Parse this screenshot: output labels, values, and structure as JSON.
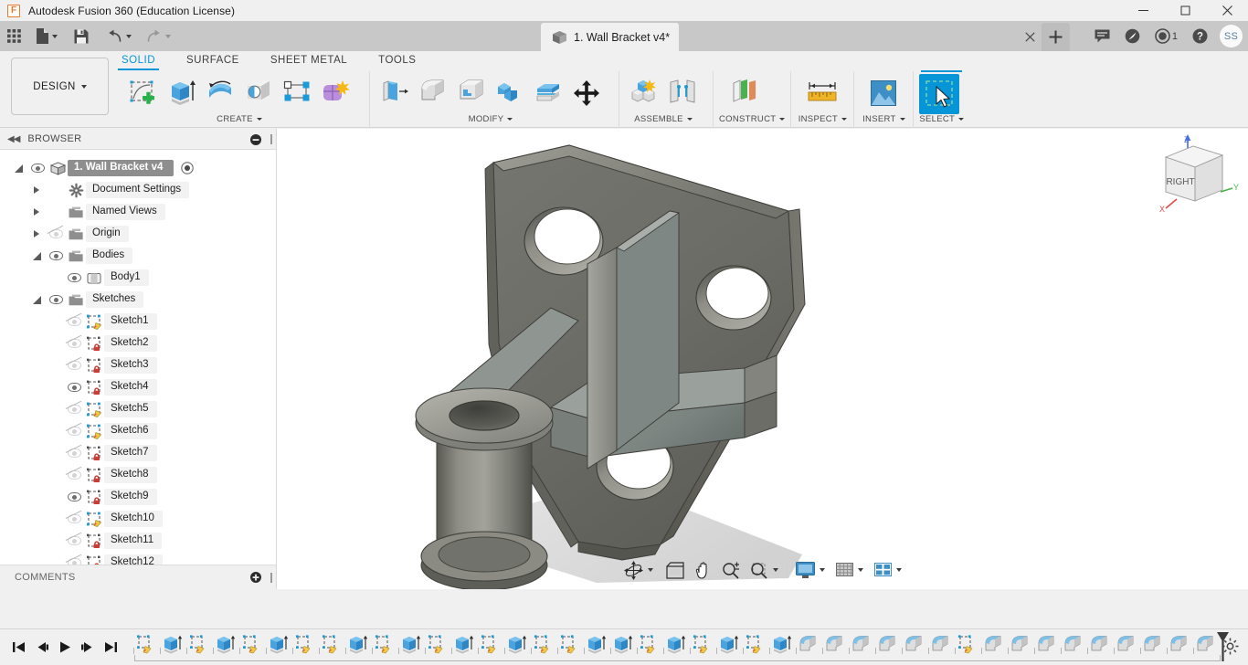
{
  "titlebar": {
    "app_title": "Autodesk Fusion 360 (Education License)",
    "app_icon": "fusion-logo-icon",
    "letter": "F",
    "minimize": "minimize-button",
    "maximize": "maximize-button",
    "close": "close-button"
  },
  "quick_access": {
    "items": [
      {
        "name": "app-grid-icon",
        "label": "",
        "dropdown": false,
        "disabled": false
      },
      {
        "name": "file-icon",
        "label": "",
        "dropdown": true,
        "disabled": false
      },
      {
        "name": "save-icon",
        "label": "",
        "dropdown": false,
        "disabled": false
      },
      {
        "name": "undo-icon",
        "label": "",
        "dropdown": true,
        "disabled": false
      },
      {
        "name": "redo-icon",
        "label": "",
        "dropdown": true,
        "disabled": true
      }
    ]
  },
  "document_tab": {
    "title": "1. Wall Bracket v4*",
    "icon": "cube-icon",
    "close_label": "×",
    "new_tab_label": "+"
  },
  "account_bar": {
    "comments_icon": "comment-icon",
    "extensions_icon": "extension-icon",
    "notifications_icon": "notification-clock-icon",
    "notifications_count": "1",
    "help_icon": "help-icon",
    "avatar_initials": "SS"
  },
  "workspace": {
    "label": "DESIGN",
    "dropdown": true
  },
  "ribbon": {
    "tabs": [
      {
        "label": "SOLID",
        "active": true
      },
      {
        "label": "SURFACE",
        "active": false
      },
      {
        "label": "SHEET METAL",
        "active": false
      },
      {
        "label": "TOOLS",
        "active": false
      }
    ],
    "panels": [
      {
        "label": "CREATE",
        "dropdown": true,
        "tools": [
          {
            "name": "create-sketch-icon"
          },
          {
            "name": "extrude-icon"
          },
          {
            "name": "revolve-icon"
          },
          {
            "name": "hole-icon"
          },
          {
            "name": "rectangular-pattern-icon"
          },
          {
            "name": "create-form-icon"
          }
        ]
      },
      {
        "label": "MODIFY",
        "dropdown": true,
        "tools": [
          {
            "name": "press-pull-icon"
          },
          {
            "name": "fillet-icon"
          },
          {
            "name": "shell-icon"
          },
          {
            "name": "combine-icon"
          },
          {
            "name": "split-face-icon"
          },
          {
            "name": "move-copy-icon"
          }
        ]
      },
      {
        "label": "ASSEMBLE",
        "dropdown": true,
        "tools": [
          {
            "name": "new-component-icon"
          },
          {
            "name": "joint-icon"
          }
        ]
      },
      {
        "label": "CONSTRUCT",
        "dropdown": true,
        "tools": [
          {
            "name": "offset-plane-icon"
          }
        ]
      },
      {
        "label": "INSPECT",
        "dropdown": true,
        "tools": [
          {
            "name": "measure-icon"
          }
        ]
      },
      {
        "label": "INSERT",
        "dropdown": true,
        "tools": [
          {
            "name": "insert-image-icon"
          }
        ]
      },
      {
        "label": "SELECT",
        "dropdown": true,
        "active": true,
        "tools": [
          {
            "name": "select-cursor-icon"
          }
        ]
      }
    ]
  },
  "browser": {
    "header_title": "BROWSER",
    "collapse_icon": "collapse-left-icon",
    "panel_toggle_icon": "minus-circle-icon",
    "nodes": [
      {
        "label": "1. Wall Bracket v4",
        "indent": 0,
        "expander": "open",
        "eye": "on",
        "icon": "component-cube-icon",
        "root": true,
        "activate": true
      },
      {
        "label": "Document Settings",
        "indent": 1,
        "expander": "closed",
        "eye": "none",
        "icon": "gear-icon"
      },
      {
        "label": "Named Views",
        "indent": 1,
        "expander": "closed",
        "eye": "none",
        "icon": "folder-icon"
      },
      {
        "label": "Origin",
        "indent": 1,
        "expander": "closed",
        "eye": "off",
        "icon": "folder-icon"
      },
      {
        "label": "Bodies",
        "indent": 1,
        "expander": "open",
        "eye": "on",
        "icon": "folder-icon"
      },
      {
        "label": "Body1",
        "indent": 2,
        "expander": "none",
        "eye": "on",
        "icon": "body-icon"
      },
      {
        "label": "Sketches",
        "indent": 1,
        "expander": "open",
        "eye": "on",
        "icon": "folder-icon"
      },
      {
        "label": "Sketch1",
        "indent": 2,
        "expander": "none",
        "eye": "off",
        "icon": "sketch-pencil-icon"
      },
      {
        "label": "Sketch2",
        "indent": 2,
        "expander": "none",
        "eye": "off",
        "icon": "sketch-lock-icon"
      },
      {
        "label": "Sketch3",
        "indent": 2,
        "expander": "none",
        "eye": "off",
        "icon": "sketch-lock-icon"
      },
      {
        "label": "Sketch4",
        "indent": 2,
        "expander": "none",
        "eye": "on",
        "icon": "sketch-lock-icon"
      },
      {
        "label": "Sketch5",
        "indent": 2,
        "expander": "none",
        "eye": "off",
        "icon": "sketch-pencil-icon"
      },
      {
        "label": "Sketch6",
        "indent": 2,
        "expander": "none",
        "eye": "off",
        "icon": "sketch-pencil-icon"
      },
      {
        "label": "Sketch7",
        "indent": 2,
        "expander": "none",
        "eye": "off",
        "icon": "sketch-lock-icon"
      },
      {
        "label": "Sketch8",
        "indent": 2,
        "expander": "none",
        "eye": "off",
        "icon": "sketch-lock-icon"
      },
      {
        "label": "Sketch9",
        "indent": 2,
        "expander": "none",
        "eye": "on",
        "icon": "sketch-lock-icon"
      },
      {
        "label": "Sketch10",
        "indent": 2,
        "expander": "none",
        "eye": "off",
        "icon": "sketch-pencil-icon"
      },
      {
        "label": "Sketch11",
        "indent": 2,
        "expander": "none",
        "eye": "off",
        "icon": "sketch-lock-icon"
      },
      {
        "label": "Sketch12",
        "indent": 2,
        "expander": "none",
        "eye": "off",
        "icon": "sketch-lock-icon"
      }
    ]
  },
  "comments": {
    "label": "COMMENTS",
    "add_icon": "plus-circle-icon"
  },
  "viewport": {
    "model_name": "wall-bracket-model",
    "background": "#ffffff",
    "body_color": "#6f6f68",
    "shadow_color": "#d8d8d8",
    "viewcube": {
      "face_label": "RIGHT",
      "axis_x": "X",
      "axis_y": "Y",
      "axis_z": "Z",
      "color_x": "#e04a4a",
      "color_y": "#49b649",
      "color_z": "#4a6fe0"
    },
    "navbar": [
      {
        "name": "orbit-icon",
        "dropdown": true
      },
      {
        "name": "look-at-icon",
        "dropdown": false
      },
      {
        "name": "pan-icon",
        "dropdown": false
      },
      {
        "name": "zoom-icon",
        "dropdown": false
      },
      {
        "name": "fit-window-icon",
        "dropdown": true
      },
      {
        "name": "display-settings-icon",
        "dropdown": true
      },
      {
        "name": "grid-snap-icon",
        "dropdown": true
      },
      {
        "name": "viewport-layout-icon",
        "dropdown": true
      }
    ]
  },
  "timeline": {
    "controls": [
      {
        "name": "go-to-beginning-button",
        "glyph": "start"
      },
      {
        "name": "step-back-button",
        "glyph": "prev"
      },
      {
        "name": "play-button",
        "glyph": "play"
      },
      {
        "name": "step-forward-button",
        "glyph": "next"
      },
      {
        "name": "go-to-end-button",
        "glyph": "end"
      }
    ],
    "features": [
      "sketch",
      "extrude",
      "sketch",
      "extrude",
      "sketch",
      "extrude",
      "sketch",
      "sketch",
      "extrude",
      "sketch",
      "extrude",
      "sketch",
      "extrude",
      "sketch",
      "extrude",
      "sketch",
      "sketch",
      "extrude",
      "extrude",
      "sketch",
      "extrude",
      "sketch",
      "extrude",
      "sketch",
      "extrude",
      "fillet",
      "fillet",
      "fillet",
      "fillet",
      "fillet",
      "fillet",
      "sketch",
      "fillet",
      "fillet",
      "fillet",
      "fillet",
      "fillet",
      "fillet",
      "fillet",
      "fillet",
      "fillet"
    ],
    "settings_icon": "timeline-settings-icon"
  }
}
